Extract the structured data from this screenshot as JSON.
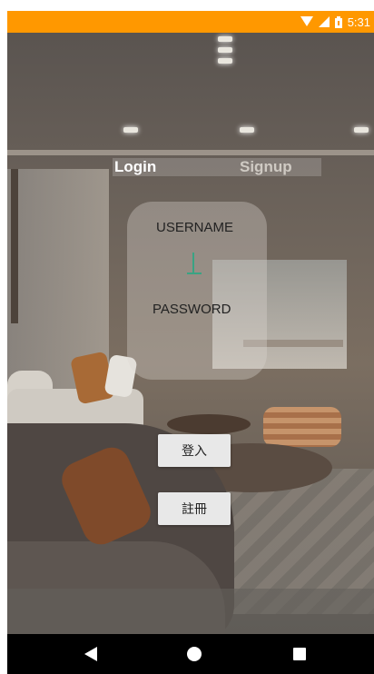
{
  "status_bar": {
    "time": "5:31",
    "icons": [
      "wifi-icon",
      "signal-icon",
      "battery-icon"
    ],
    "color": "#FF9800"
  },
  "tabs": [
    {
      "label": "Login",
      "selected": true
    },
    {
      "label": "Signup",
      "selected": false
    }
  ],
  "form": {
    "username_label": "USERNAME",
    "password_label": "PASSWORD",
    "accent_color": "#3AA383"
  },
  "buttons": {
    "login_label": "登入",
    "register_label": "註冊"
  },
  "nav_bar": {
    "icons": [
      "back-icon",
      "home-icon",
      "recent-apps-icon"
    ]
  }
}
